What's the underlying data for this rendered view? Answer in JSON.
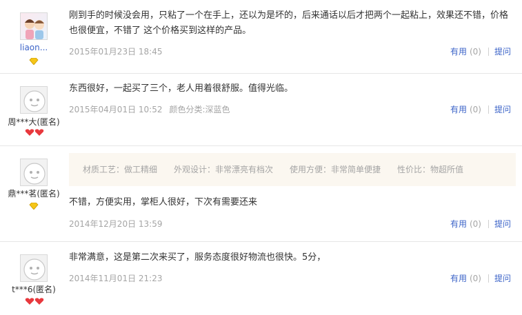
{
  "reviews": [
    {
      "user": "liaon...",
      "content": "刚到手的时候没会用，只粘了一个在手上，还以为是坏的，后来通话以后才把两个一起粘上，效果还不错，价格也很便宜，不错了 这个价格买到这样的产品。",
      "date": "2015年01月23日 18:45",
      "useful_label": "有用",
      "useful_count": "(0)",
      "ask_label": "提问",
      "badge": "yellow-diamond-icon"
    },
    {
      "user": "周***大(匿名)",
      "content": "东西很好，一起买了三个，老人用着很舒服。值得光临。",
      "date": "2015年04月01日 10:52",
      "spec": "颜色分类:深蓝色",
      "useful_label": "有用",
      "useful_count": "(0)",
      "ask_label": "提问",
      "badge": "red-heart-icon"
    },
    {
      "user": "鼎***茗(匿名)",
      "tags": [
        "材质工艺：做工精细",
        "外观设计：非常漂亮有档次",
        "使用方便：非常简单便捷",
        "性价比：物超所值"
      ],
      "content": "不错，方便实用，掌柜人很好，下次有需要还来",
      "date": "2014年12月20日 13:59",
      "useful_label": "有用",
      "useful_count": "(0)",
      "ask_label": "提问",
      "badge": "yellow-diamond-icon"
    },
    {
      "user": "t***6(匿名)",
      "content": "非常满意，这是第二次来买了，服务态度很好物流也很快。5分，",
      "date": "2014年11月01日 21:23",
      "useful_label": "有用",
      "useful_count": "(0)",
      "ask_label": "提问",
      "badge": "red-heart-icon"
    }
  ],
  "colors": {
    "link": "#3c64c8",
    "muted": "#a5a5a5",
    "text": "#333333",
    "tag_bg": "#fbf7f0",
    "divider": "#e6e6e6"
  }
}
